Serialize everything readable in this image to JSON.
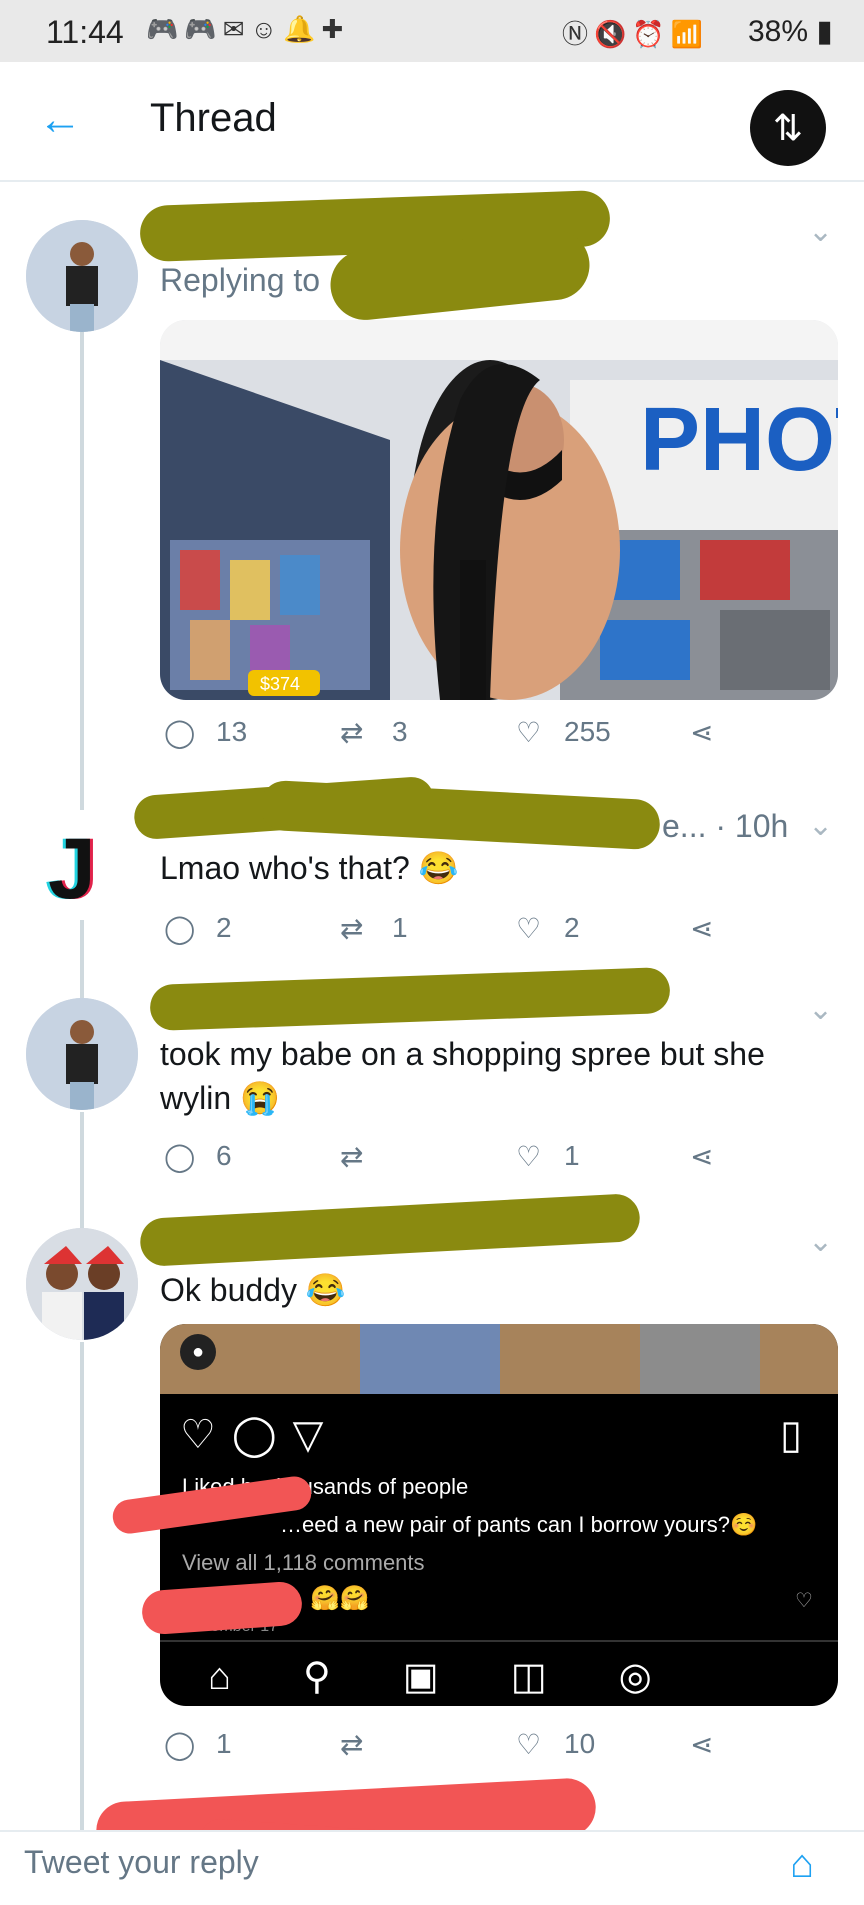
{
  "status_bar": {
    "time": "11:44",
    "battery_percent": "38%"
  },
  "header": {
    "title": "Thread"
  },
  "tweets": [
    {
      "replying_to": "Replying to",
      "image_price_tag": "$374",
      "image_sign": "PHOT",
      "replies": "13",
      "retweets": "3",
      "likes": "255"
    },
    {
      "meta": "e... · 10h",
      "text": "Lmao who's that? 😂",
      "replies": "2",
      "retweets": "1",
      "likes": "2"
    },
    {
      "text": "took my babe on a shopping spree but she wylin 😭",
      "replies": "6",
      "retweets": "",
      "likes": "1"
    },
    {
      "text": "Ok buddy 😂",
      "replies": "1",
      "retweets": "",
      "likes": "10",
      "embed": {
        "liked_by": "Liked by thousands of people",
        "caption": "…eed a new pair of pants can I borrow yours?☺️",
        "view_comments": "View all 1,118 comments",
        "comment_emoji": "🤗🤗",
        "date": "December 17"
      }
    }
  ],
  "footer": {
    "reply_placeholder": "Tweet your reply"
  },
  "colors": {
    "accent": "#1da1f2",
    "scribble_olive": "#8a8a10",
    "scribble_red": "#f25555"
  }
}
